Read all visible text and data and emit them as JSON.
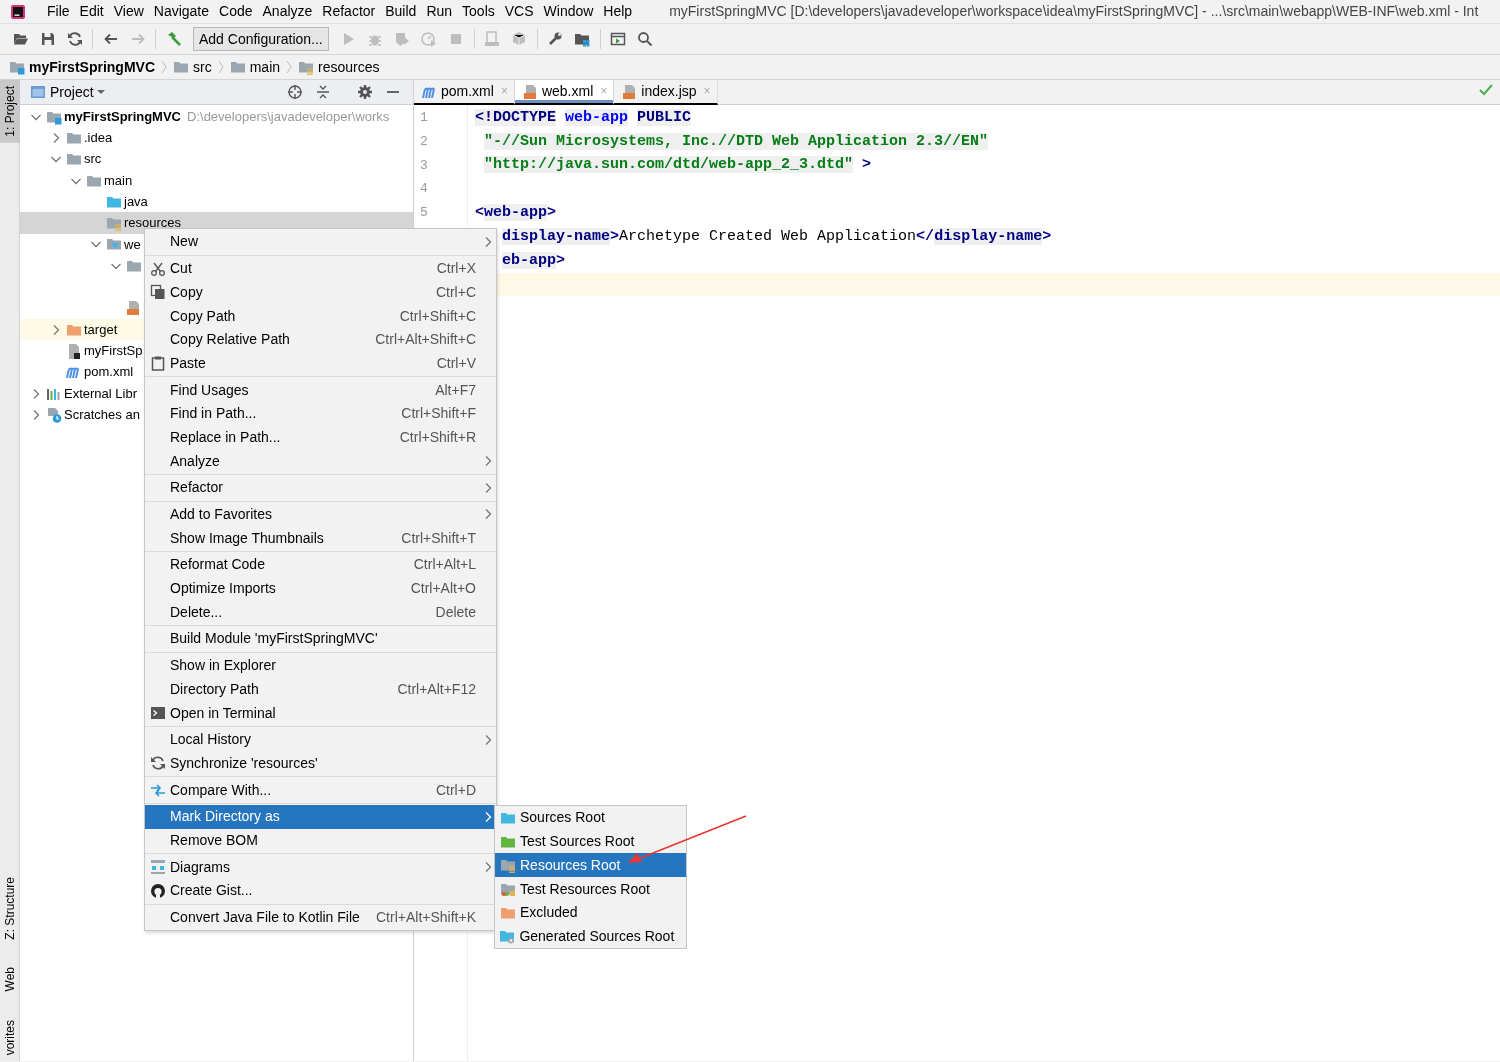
{
  "menu_bar": {
    "items": [
      "File",
      "Edit",
      "View",
      "Navigate",
      "Code",
      "Analyze",
      "Refactor",
      "Build",
      "Run",
      "Tools",
      "VCS",
      "Window",
      "Help"
    ],
    "title": "myFirstSpringMVC [D:\\developers\\javadeveloper\\workspace\\idea\\myFirstSpringMVC] - ...\\src\\main\\webapp\\WEB-INF\\web.xml - Int"
  },
  "toolbar": {
    "items": [
      {
        "kind": "open",
        "disabled": false
      },
      {
        "kind": "save",
        "disabled": false
      },
      {
        "kind": "sync",
        "disabled": false
      },
      {
        "kind": "separator"
      },
      {
        "kind": "back",
        "disabled": false
      },
      {
        "kind": "forward",
        "disabled": true
      },
      {
        "kind": "separator"
      },
      {
        "kind": "build",
        "disabled": false
      },
      {
        "kind": "config",
        "label": "Add Configuration...",
        "disabled": false
      },
      {
        "kind": "run",
        "disabled": true
      },
      {
        "kind": "debug",
        "disabled": true
      },
      {
        "kind": "coverage",
        "disabled": true
      },
      {
        "kind": "profile",
        "disabled": true
      },
      {
        "kind": "stop",
        "disabled": true
      },
      {
        "kind": "separator"
      },
      {
        "kind": "device",
        "disabled": true
      },
      {
        "kind": "package",
        "disabled": true
      },
      {
        "kind": "separator"
      },
      {
        "kind": "wrench",
        "disabled": false
      },
      {
        "kind": "structure",
        "disabled": false
      },
      {
        "kind": "separator"
      },
      {
        "kind": "window",
        "disabled": false
      },
      {
        "kind": "search",
        "disabled": false
      }
    ]
  },
  "breadcrumb": [
    {
      "label": "myFirstSpringMVC",
      "kind": "module"
    },
    {
      "label": "src",
      "kind": "folder"
    },
    {
      "label": "main",
      "kind": "folder"
    },
    {
      "label": "resources",
      "kind": "resources"
    }
  ],
  "left_stripe": {
    "top": [
      {
        "label": "1: Project",
        "selected": true
      }
    ],
    "bottom": [
      {
        "label": "Z: Structure",
        "selected": false
      },
      {
        "label": "Web",
        "selected": false
      },
      {
        "label": "vorites",
        "selected": false
      }
    ]
  },
  "project_panel": {
    "title": "Project",
    "tree": [
      {
        "label": "myFirstSpringMVC",
        "path": "D:\\developers\\javadeveloper\\works",
        "kind": "module",
        "expanded": true,
        "selected": false,
        "children": [
          {
            "label": ".idea",
            "kind": "folder",
            "expanded": false,
            "selected": false
          },
          {
            "label": "src",
            "kind": "folder",
            "expanded": true,
            "selected": false,
            "children": [
              {
                "label": "main",
                "kind": "folder",
                "expanded": true,
                "selected": false,
                "children": [
                  {
                    "label": "java",
                    "kind": "source",
                    "selected": false
                  },
                  {
                    "label": "resources",
                    "kind": "resources",
                    "selected": true
                  },
                  {
                    "label": "we",
                    "kind": "web",
                    "expanded": true,
                    "selected": false,
                    "children": [
                      {
                        "kind": "folder",
                        "expanded": true,
                        "selected": false,
                        "children": [
                          {
                            "selected": false
                          }
                        ]
                      },
                      {
                        "kind": "jsp",
                        "selected": false
                      }
                    ]
                  }
                ]
              }
            ]
          },
          {
            "label": "target",
            "kind": "excluded",
            "expanded": false,
            "selected": false
          },
          {
            "label": "myFirstSp",
            "kind": "iml",
            "selected": false
          },
          {
            "label": "pom.xml",
            "kind": "maven",
            "selected": false
          }
        ]
      },
      {
        "label": "External Libr",
        "kind": "library",
        "expanded": false,
        "selected": false
      },
      {
        "label": "Scratches an",
        "kind": "scratches",
        "expanded": false,
        "selected": false
      }
    ]
  },
  "editor": {
    "tabs": [
      {
        "label": "pom.xml",
        "kind": "maven",
        "close": "×",
        "selected": false
      },
      {
        "label": "web.xml",
        "kind": "xml",
        "close": "×",
        "selected": true
      },
      {
        "label": "index.jsp",
        "kind": "jsp",
        "close": "×",
        "selected": false
      }
    ],
    "lines": [
      {
        "number": "1",
        "kind": "plain",
        "current": false,
        "tokens": [
          {
            "text": "<!DOCTYPE",
            "kind": "keyword"
          },
          {
            "text": "web-app",
            "kind": "name",
            "gap": true
          },
          {
            "text": "PUBLIC",
            "kind": "keyword",
            "gap": true
          }
        ]
      },
      {
        "number": "2",
        "kind": "continued",
        "current": false,
        "tokens": [
          {
            "text": "\"-//Sun Microsystems, Inc.//DTD Web Application 2.3//EN\"",
            "kind": "string"
          }
        ]
      },
      {
        "number": "3",
        "kind": "continued",
        "current": false,
        "tokens": [
          {
            "text": "\"http://java.sun.com/dtd/web-app_2_3.dtd\"",
            "kind": "string"
          },
          {
            "text": ">",
            "kind": "bracket",
            "gap": true
          }
        ]
      },
      {
        "number": "4",
        "kind": "plain",
        "current": false
      },
      {
        "number": "5",
        "kind": "plain",
        "current": false,
        "tokens": [
          {
            "text": "<",
            "kind": "bracket"
          },
          {
            "text": "web-app",
            "kind": "tag"
          },
          {
            "text": ">",
            "kind": "bracket"
          }
        ]
      },
      {
        "kind": "covered",
        "current": false,
        "tokens": [
          {
            "text": "display-name",
            "kind": "tag"
          },
          {
            "text": ">",
            "kind": "bracket"
          },
          {
            "text": "Archetype Created Web Application",
            "kind": "text"
          },
          {
            "text": "</",
            "kind": "bracket"
          },
          {
            "text": "display-name",
            "kind": "tag"
          },
          {
            "text": ">",
            "kind": "bracket"
          }
        ]
      },
      {
        "kind": "covered",
        "current": false,
        "tokens": [
          {
            "text": "eb-app",
            "kind": "tag"
          },
          {
            "text": ">",
            "kind": "bracket"
          }
        ]
      },
      {
        "kind": "plain",
        "current": true
      }
    ]
  },
  "context_menu": {
    "groups": [
      [
        {
          "label": "New",
          "kind": "plain",
          "submenu": true,
          "selected": false
        }
      ],
      [
        {
          "label": "Cut",
          "shortcut": "Ctrl+X",
          "kind": "cut",
          "submenu": false,
          "selected": false
        },
        {
          "label": "Copy",
          "shortcut": "Ctrl+C",
          "kind": "copy",
          "submenu": false,
          "selected": false
        },
        {
          "label": "Copy Path",
          "shortcut": "Ctrl+Shift+C",
          "kind": "plain",
          "submenu": false,
          "selected": false
        },
        {
          "label": "Copy Relative Path",
          "shortcut": "Ctrl+Alt+Shift+C",
          "kind": "plain",
          "submenu": false,
          "selected": false
        },
        {
          "label": "Paste",
          "shortcut": "Ctrl+V",
          "kind": "paste",
          "submenu": false,
          "selected": false
        }
      ],
      [
        {
          "label": "Find Usages",
          "shortcut": "Alt+F7",
          "kind": "plain",
          "submenu": false,
          "selected": false
        },
        {
          "label": "Find in Path...",
          "shortcut": "Ctrl+Shift+F",
          "kind": "plain",
          "submenu": false,
          "selected": false
        },
        {
          "label": "Replace in Path...",
          "shortcut": "Ctrl+Shift+R",
          "kind": "plain",
          "submenu": false,
          "selected": false
        },
        {
          "label": "Analyze",
          "kind": "plain",
          "submenu": true,
          "selected": false
        }
      ],
      [
        {
          "label": "Refactor",
          "kind": "plain",
          "submenu": true,
          "selected": false
        }
      ],
      [
        {
          "label": "Add to Favorites",
          "kind": "plain",
          "submenu": true,
          "selected": false
        },
        {
          "label": "Show Image Thumbnails",
          "shortcut": "Ctrl+Shift+T",
          "kind": "plain",
          "submenu": false,
          "selected": false
        }
      ],
      [
        {
          "label": "Reformat Code",
          "shortcut": "Ctrl+Alt+L",
          "kind": "plain",
          "submenu": false,
          "selected": false
        },
        {
          "label": "Optimize Imports",
          "shortcut": "Ctrl+Alt+O",
          "kind": "plain",
          "submenu": false,
          "selected": false
        },
        {
          "label": "Delete...",
          "shortcut": "Delete",
          "kind": "plain",
          "submenu": false,
          "selected": false
        }
      ],
      [
        {
          "label": "Build Module 'myFirstSpringMVC'",
          "kind": "plain",
          "submenu": false,
          "selected": false
        }
      ],
      [
        {
          "label": "Show in Explorer",
          "kind": "plain",
          "submenu": false,
          "selected": false
        },
        {
          "label": "Directory Path",
          "shortcut": "Ctrl+Alt+F12",
          "kind": "plain",
          "submenu": false,
          "selected": false
        },
        {
          "label": "Open in Terminal",
          "kind": "terminal",
          "submenu": false,
          "selected": false
        }
      ],
      [
        {
          "label": "Local History",
          "kind": "plain",
          "submenu": true,
          "selected": false
        },
        {
          "label": "Synchronize 'resources'",
          "kind": "sync",
          "submenu": false,
          "selected": false
        }
      ],
      [
        {
          "label": "Compare With...",
          "shortcut": "Ctrl+D",
          "kind": "compare",
          "submenu": false,
          "selected": false
        }
      ],
      [
        {
          "label": "Mark Directory as",
          "kind": "plain",
          "submenu": true,
          "selected": true
        },
        {
          "label": "Remove BOM",
          "kind": "plain",
          "submenu": false,
          "selected": false
        }
      ],
      [
        {
          "label": "Diagrams",
          "kind": "diagrams",
          "submenu": true,
          "selected": false
        },
        {
          "label": "Create Gist...",
          "kind": "gist",
          "submenu": false,
          "selected": false
        }
      ],
      [
        {
          "label": "Convert Java File to Kotlin File",
          "shortcut": "Ctrl+Alt+Shift+K",
          "kind": "plain",
          "submenu": false,
          "selected": false
        }
      ]
    ]
  },
  "submenu": {
    "items": [
      {
        "label": "Sources Root",
        "kind": "source",
        "selected": false
      },
      {
        "label": "Test Sources Root",
        "kind": "test-source",
        "selected": false
      },
      {
        "label": "Resources Root",
        "kind": "resources",
        "selected": true
      },
      {
        "label": "Test Resources Root",
        "kind": "test-resources",
        "selected": false
      },
      {
        "label": "Excluded",
        "kind": "excluded",
        "selected": false
      },
      {
        "label": "Generated Sources Root",
        "kind": "generated",
        "selected": false
      }
    ]
  },
  "annotations": [
    {
      "kind": "arrow"
    }
  ]
}
